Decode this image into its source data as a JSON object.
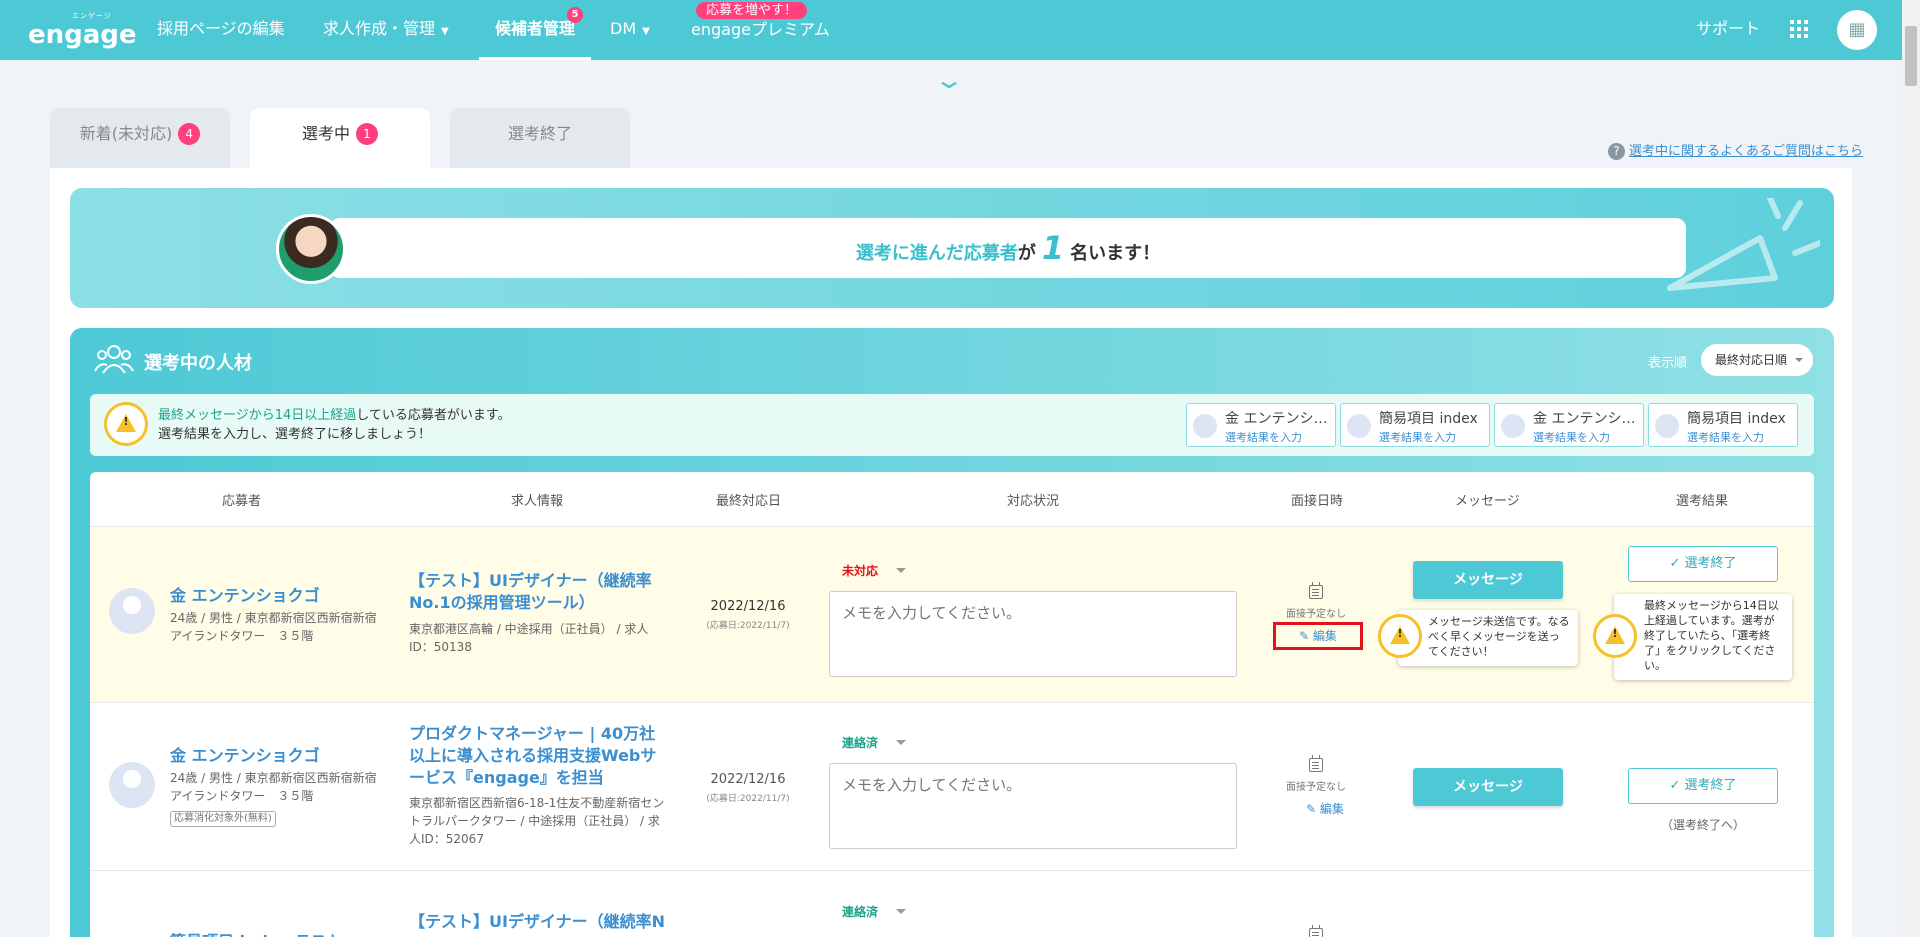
{
  "header": {
    "logo_sub": "エンゲージ",
    "logo": "engage",
    "nav": [
      {
        "label": "採用ページの編集"
      },
      {
        "label": "求人作成・管理"
      },
      {
        "label": "候補者管理",
        "badge": "5"
      },
      {
        "label": "DM"
      },
      {
        "label": "engageプレミアム",
        "promo": "応募を増やす！"
      }
    ],
    "support": "サポート",
    "brand_color": "#4dc9d6"
  },
  "tabs": [
    {
      "label": "新着(未対応)",
      "badge": "4"
    },
    {
      "label": "選考中",
      "badge": "1"
    },
    {
      "label": "選考終了"
    }
  ],
  "faq_link": "選考中に関するよくあるご質問はこちら",
  "banner": {
    "part1": "選考に進んだ応募者",
    "part2": "が",
    "count": "1",
    "part3": "名います！"
  },
  "section": {
    "title": "選考中の人材",
    "sort_label": "表示順",
    "sort_value": "最終対応日順"
  },
  "alert": {
    "highlight": "最終メッセージから14日以上経過",
    "line1_rest": "している応募者がいます。",
    "line2": "選考結果を入力し、選考終了に移しましょう！",
    "chips": [
      {
        "name": "金 エンテンショクゴ",
        "link": "選考結果を入力"
      },
      {
        "name": "簡易項目 index",
        "link": "選考結果を入力"
      },
      {
        "name": "金 エンテンショクゴ",
        "link": "選考結果を入力"
      },
      {
        "name": "簡易項目 index",
        "link": "選考結果を入力"
      }
    ]
  },
  "table": {
    "headers": [
      "応募者",
      "求人情報",
      "最終対応日",
      "対応状況",
      "面接日時",
      "メッセージ",
      "選考結果"
    ],
    "rows": [
      {
        "name": "金 エンテンショクゴ",
        "info": "24歳 / 男性 / 東京都新宿区西新宿新宿アイランドタワー　３５階",
        "job_title": "【テスト】UIデザイナー（継続率No.1の採用管理ツール）",
        "job_info": "東京都港区高輪 / 中途採用（正社員） / 求人ID：50138",
        "date": "2022/12/16",
        "applied": "(応募日:2022/11/7)",
        "status": "未対応",
        "status_color": "#e0131a",
        "memo_placeholder": "メモを入力してください。",
        "no_schedule": "面接予定なし",
        "edit": "✎ 編集",
        "message_btn": "メッセージ",
        "msg_warning": "メッセージ未送信です。なるべく早くメッセージを送ってください！",
        "end_btn": "✓ 選考終了",
        "end_warning": "最終メッセージから14日以上経過しています。選考が終了していたら、「選考終了」をクリックしてください。"
      },
      {
        "name": "金 エンテンショクゴ",
        "info": "24歳 / 男性 / 東京都新宿区西新宿新宿アイランドタワー　３５階",
        "tag": "応募消化対象外(無料)",
        "job_title": "プロダクトマネージャー | 40万社以上に導入される採用支援Webサービス『engage』を担当",
        "job_info": "東京都新宿区西新宿6-18-1住友不動産新宿セントラルパークタワー / 中途採用（正社員） / 求人ID：52067",
        "date": "2022/12/16",
        "applied": "(応募日:2022/11/7)",
        "status": "連絡済",
        "status_color": "#1aa38a",
        "memo_placeholder": "メモを入力してください。",
        "no_schedule": "面接予定なし",
        "edit": "✎ 編集",
        "message_btn": "メッセージ",
        "end_btn": "✓ 選考終了",
        "end_note": "（選考終了へ）"
      },
      {
        "name": "簡易項目 index テスト",
        "job_title": "【テスト】UIデザイナー（継続率N",
        "status": "連絡済"
      }
    ]
  }
}
